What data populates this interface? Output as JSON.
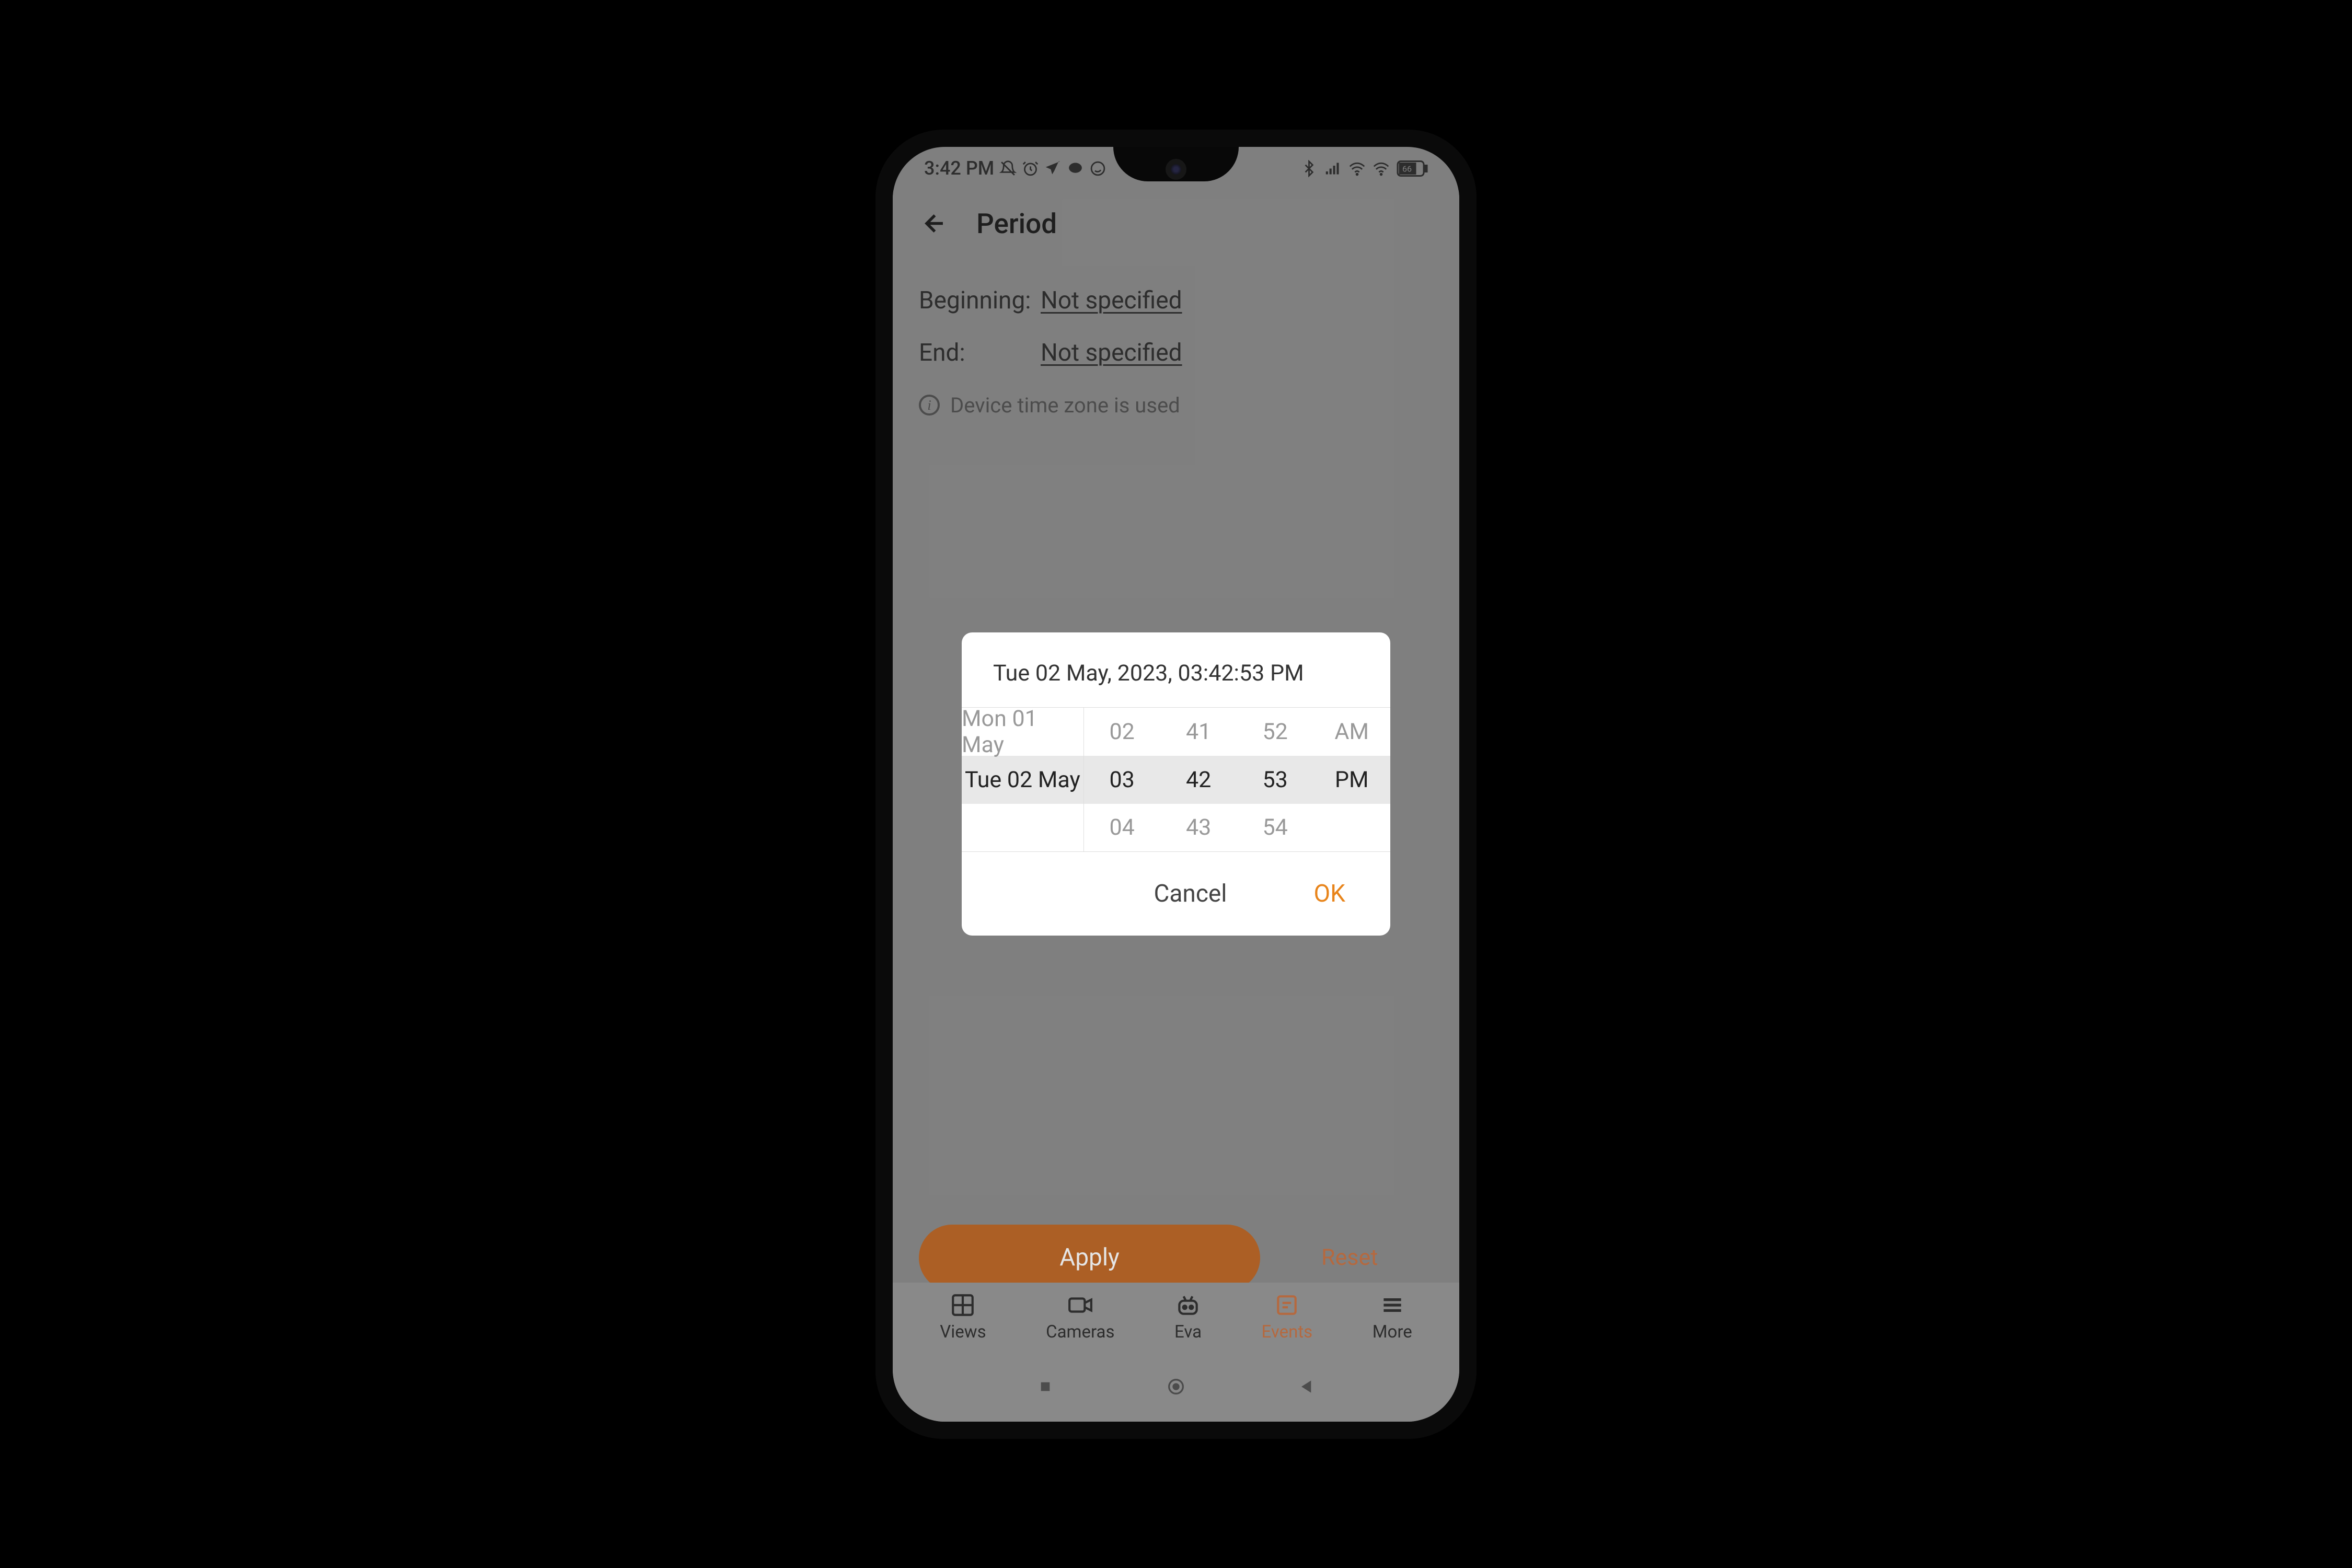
{
  "status_bar": {
    "time": "3:42 PM",
    "battery": "66"
  },
  "header": {
    "title": "Period"
  },
  "period": {
    "beginning_label": "Beginning:",
    "beginning_value": "Not specified",
    "end_label": "End:",
    "end_value": "Not specified",
    "info_text": "Device time zone is used"
  },
  "actions": {
    "apply": "Apply",
    "reset": "Reset"
  },
  "picker": {
    "title": "Tue 02 May, 2023, 03:42:53 PM",
    "date": {
      "prev": "Mon 01 May",
      "selected": "Tue 02 May",
      "next": ""
    },
    "hour": {
      "prev": "02",
      "selected": "03",
      "next": "04"
    },
    "minute": {
      "prev": "41",
      "selected": "42",
      "next": "43"
    },
    "second": {
      "prev": "52",
      "selected": "53",
      "next": "54"
    },
    "ampm": {
      "prev": "AM",
      "selected": "PM",
      "next": ""
    },
    "cancel": "Cancel",
    "ok": "OK"
  },
  "nav": {
    "items": [
      {
        "label": "Views"
      },
      {
        "label": "Cameras"
      },
      {
        "label": "Eva"
      },
      {
        "label": "Events"
      },
      {
        "label": "More"
      }
    ]
  }
}
